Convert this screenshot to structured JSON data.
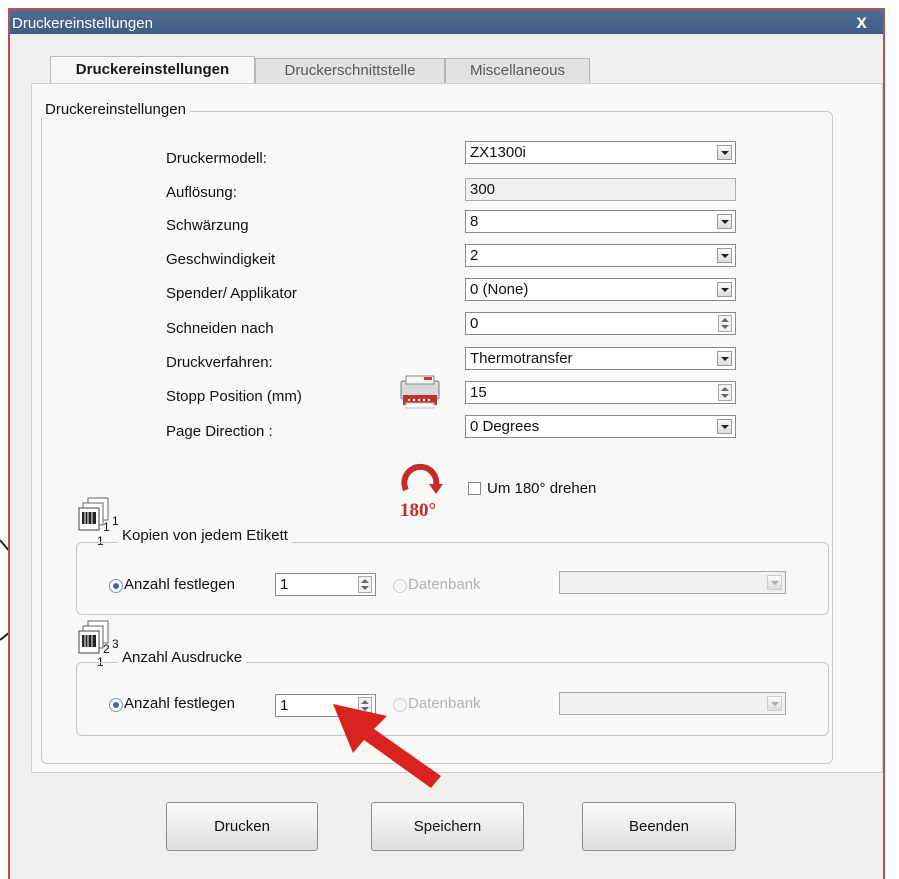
{
  "window": {
    "title": "Druckereinstellungen",
    "close": "x"
  },
  "tabs": [
    {
      "label": "Druckereinstellungen",
      "active": true
    },
    {
      "label": "Druckerschnittstelle",
      "active": false
    },
    {
      "label": "Miscellaneous",
      "active": false
    }
  ],
  "settings": {
    "group_title": "Druckereinstellungen",
    "rows": [
      {
        "label": "Druckermodell:",
        "value": "ZX1300i",
        "control": "dropdown"
      },
      {
        "label": "Auflösung:",
        "value": "300",
        "control": "readonly"
      },
      {
        "label": "Schwärzung",
        "value": "8",
        "control": "dropdown"
      },
      {
        "label": "Geschwindigkeit",
        "value": "2",
        "control": "dropdown"
      },
      {
        "label": "Spender/ Applikator",
        "value": "0 (None)",
        "control": "dropdown"
      },
      {
        "label": "Schneiden nach",
        "value": "0",
        "control": "spinner"
      },
      {
        "label": "Druckverfahren:",
        "value": "Thermotransfer",
        "control": "dropdown"
      },
      {
        "label": "Stopp Position (mm)",
        "value": "15",
        "control": "spinner"
      },
      {
        "label": "Page Direction :",
        "value": "0 Degrees",
        "control": "dropdown"
      }
    ],
    "rotate": {
      "icon_text": "180°",
      "checkbox_label": "Um 180° drehen",
      "checked": false
    }
  },
  "copies": {
    "icon_numbers": {
      "sup": "1",
      "sup2": "1",
      "sub": "1"
    },
    "title": "Kopien von jedem Etikett",
    "radio_fixed": "Anzahl festlegen",
    "value": "1",
    "radio_db": "Datenbank"
  },
  "prints": {
    "icon_numbers": {
      "sup": "2",
      "sup2": "3",
      "sub": "1"
    },
    "title": "Anzahl Ausdrucke",
    "radio_fixed": "Anzahl festlegen",
    "value": "1",
    "radio_db": "Datenbank"
  },
  "buttons": {
    "print": "Drucken",
    "save": "Speichern",
    "exit": "Beenden"
  },
  "colors": {
    "titlebar": "#4a6a8f",
    "frame": "#b9504f",
    "arrow": "#d8231f"
  }
}
